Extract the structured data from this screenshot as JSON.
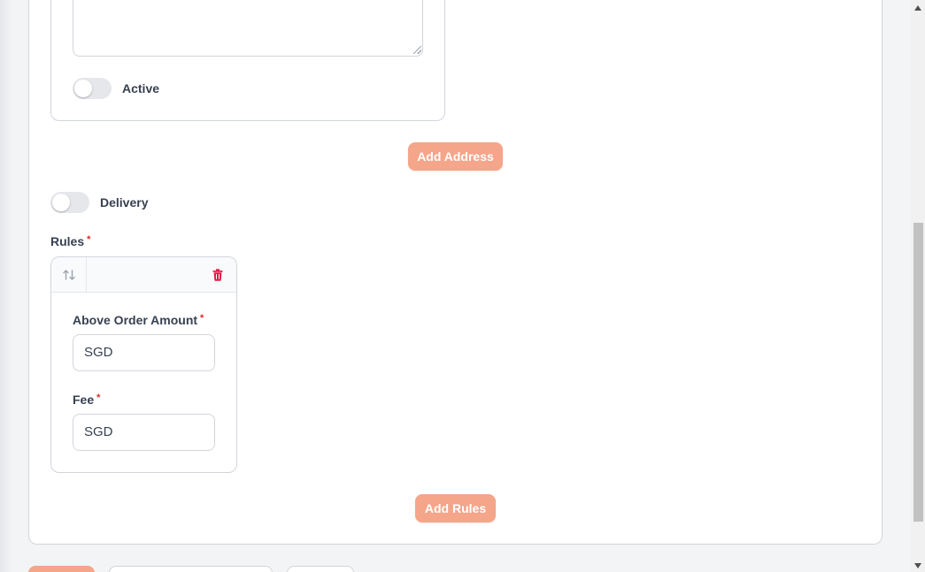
{
  "address": {
    "textarea_value": "",
    "active_label": "Active",
    "active_on": false
  },
  "add_address_label": "Add Address",
  "delivery": {
    "label": "Delivery",
    "on": false
  },
  "rules": {
    "label": "Rules",
    "required_mark": "*",
    "items": [
      {
        "above_order_amount_label": "Above Order Amount",
        "above_order_amount_value": "SGD",
        "fee_label": "Fee",
        "fee_value": "SGD"
      }
    ]
  },
  "add_rules_label": "Add Rules",
  "colors": {
    "primary_button": "#f4a58a",
    "delete_icon": "#e11d48",
    "required": "#dc2626",
    "toggle_off": "#e5e7eb"
  },
  "icons": {
    "reorder": "arrows-up-down-icon",
    "delete": "trash-icon"
  }
}
